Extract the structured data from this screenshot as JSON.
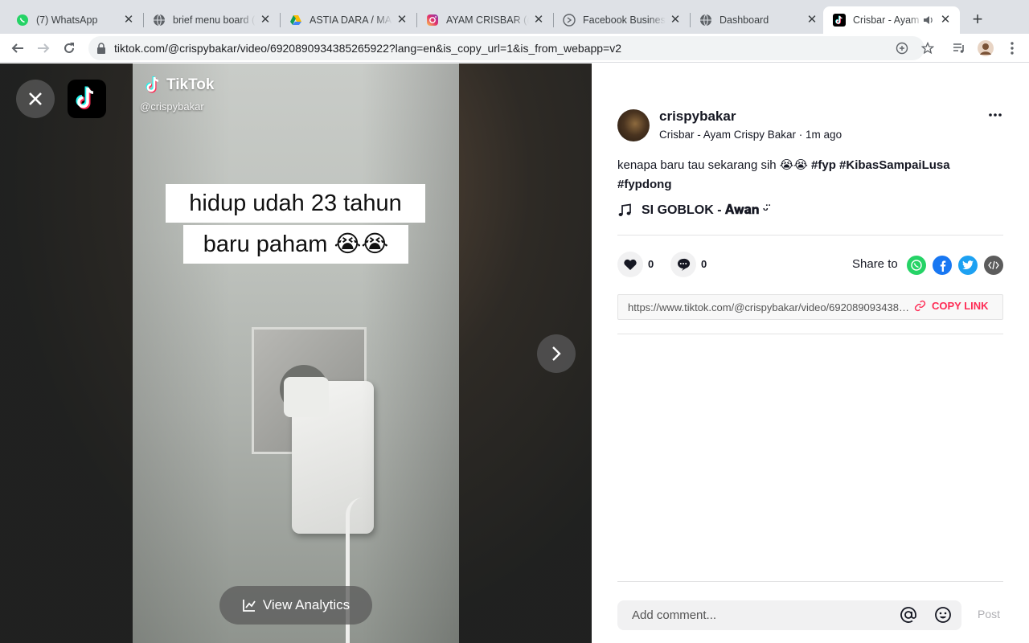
{
  "browser": {
    "tabs": [
      {
        "title": "(7) WhatsApp",
        "icon": "whatsapp-icon"
      },
      {
        "title": "brief menu board (",
        "icon": "globe-icon"
      },
      {
        "title": "ASTIA DARA / MAI",
        "icon": "google-drive-icon"
      },
      {
        "title": "AYAM CRISBAR (@",
        "icon": "instagram-icon"
      },
      {
        "title": "Facebook Busines",
        "icon": "facebook-business-icon"
      },
      {
        "title": "Dashboard",
        "icon": "globe-icon"
      },
      {
        "title": "Crisbar - Ayam",
        "icon": "tiktok-icon",
        "active": true
      }
    ],
    "new_tab_label": "+",
    "url": "tiktok.com/@crispybakar/video/6920890934385265922?lang=en&is_copy_url=1&is_from_webapp=v2"
  },
  "video": {
    "watermark": "TikTok",
    "handle": "@crispybakar",
    "caption_line1": "hidup udah 23 tahun",
    "caption_line2": "baru paham 😭😭",
    "analytics_label": "View Analytics"
  },
  "post": {
    "username": "crispybakar",
    "display_name": "Crisbar - Ayam Crispy Bakar",
    "time_ago": "1m ago",
    "sub_sep": " · ",
    "desc_text": "kenapa baru tau sekarang sih 😭😭 ",
    "tags": [
      "#fyp",
      "#KibasSampaiLusa",
      "#fypdong"
    ],
    "music": "SI GOBLOK - 𝐀𝐰𝐚𝐧 ᵕ̈",
    "likes": "0",
    "comments": "0",
    "share_label": "Share to",
    "share_targets": [
      "whatsapp",
      "facebook",
      "twitter",
      "embed"
    ],
    "link": "https://www.tiktok.com/@crispybakar/video/6920890934385265922?lang=en&is_copy_url=1&is_from_webapp=v2",
    "copy_label": "COPY LINK",
    "comment_placeholder": "Add comment...",
    "post_label": "Post"
  },
  "colors": {
    "accent": "#fe2c55",
    "whatsapp": "#25d366",
    "facebook": "#1877f2",
    "twitter": "#1da1f2",
    "embed": "#5c5c5c"
  }
}
